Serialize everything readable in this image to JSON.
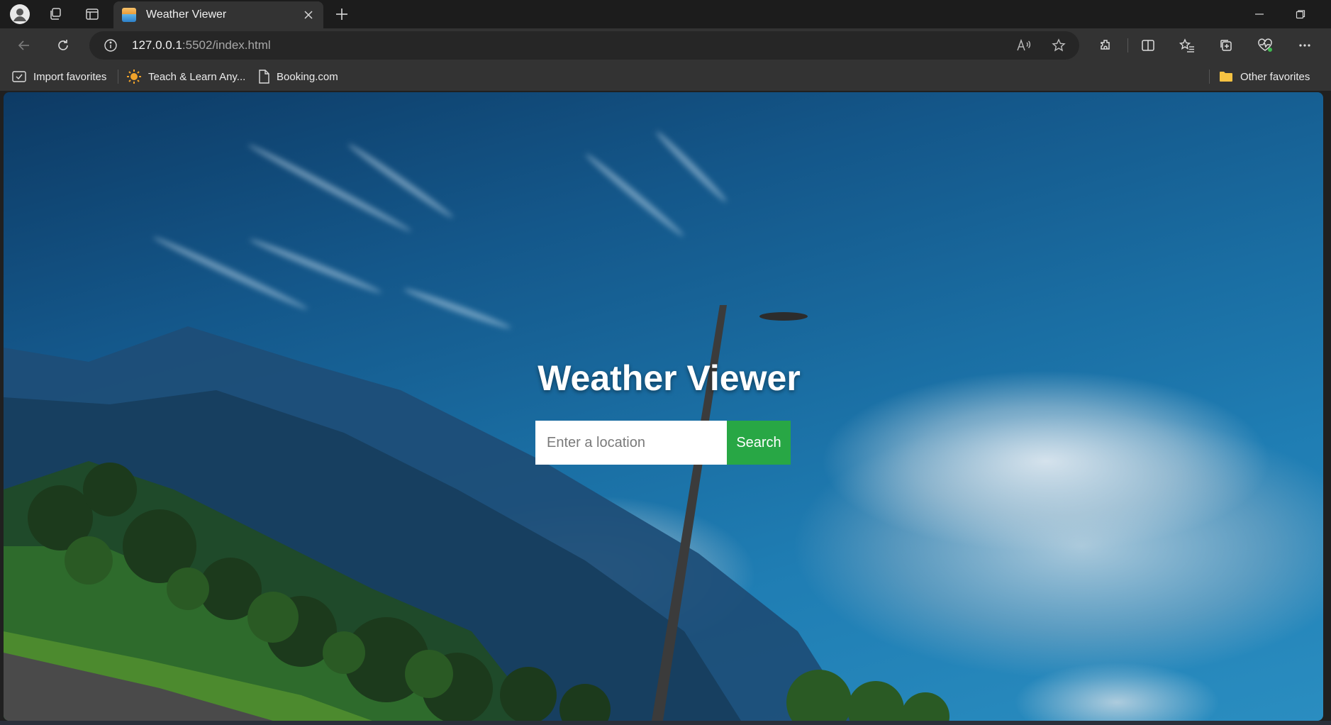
{
  "browser": {
    "tab_title": "Weather Viewer",
    "url_host": "127.0.0.1",
    "url_rest": ":5502/index.html",
    "favorites": [
      {
        "label": "Import favorites",
        "icon": "import-icon"
      },
      {
        "label": "Teach & Learn Any...",
        "icon": "sun-icon"
      },
      {
        "label": "Booking.com",
        "icon": "page-icon"
      }
    ],
    "other_favorites": "Other favorites"
  },
  "page": {
    "title": "Weather Viewer",
    "search_placeholder": "Enter a location",
    "search_value": "",
    "search_button": "Search",
    "accent_color": "#28a745"
  }
}
